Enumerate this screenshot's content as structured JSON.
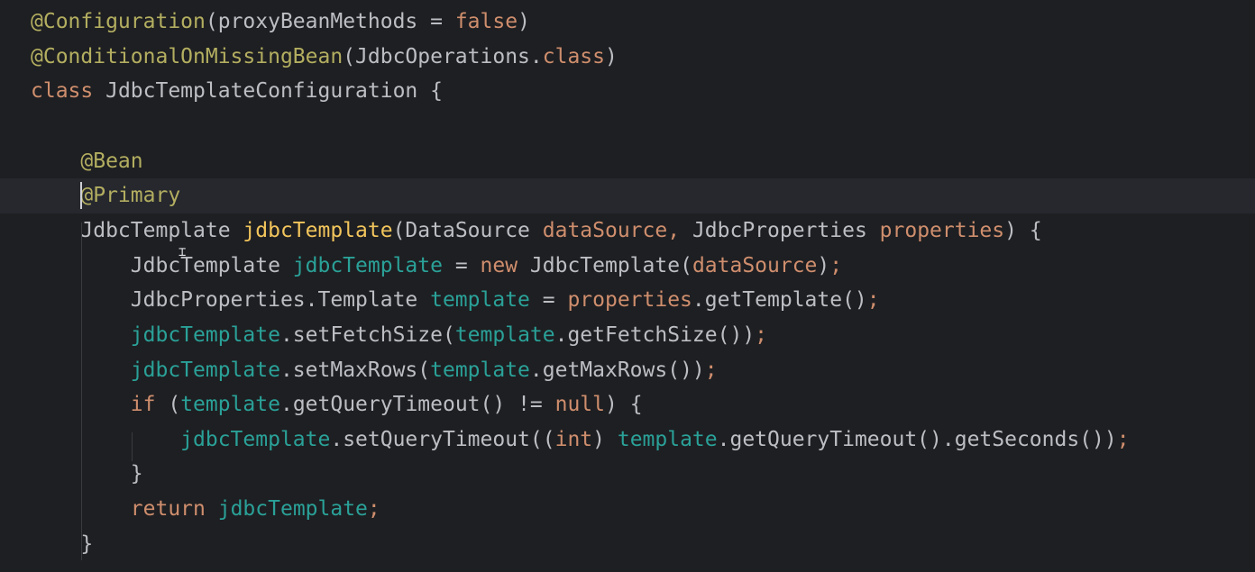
{
  "editor": {
    "colors": {
      "background": "#1e1f22",
      "text": "#bcbec4",
      "annotation": "#b3ae60",
      "keyword": "#cf8e6d",
      "method_declaration": "#f2c55c",
      "parameter": "#cf8e6d",
      "local_variable": "#2aa198",
      "current_line": "#26282e"
    },
    "lines": [
      {
        "tokens": [
          {
            "t": "@Configuration",
            "c": "annotation"
          },
          {
            "t": "(proxyBeanMethods = ",
            "c": "plain"
          },
          {
            "t": "false",
            "c": "keyword"
          },
          {
            "t": ")",
            "c": "plain"
          }
        ]
      },
      {
        "tokens": [
          {
            "t": "@ConditionalOnMissingBean",
            "c": "annotation"
          },
          {
            "t": "(JdbcOperations.",
            "c": "plain"
          },
          {
            "t": "class",
            "c": "keyword"
          },
          {
            "t": ")",
            "c": "plain"
          }
        ]
      },
      {
        "tokens": [
          {
            "t": "class",
            "c": "keyword"
          },
          {
            "t": " JdbcTemplateConfiguration {",
            "c": "plain"
          }
        ]
      },
      {
        "tokens": []
      },
      {
        "tokens": [
          {
            "t": "    ",
            "c": "plain"
          },
          {
            "t": "@Bean",
            "c": "annotation"
          }
        ]
      },
      {
        "tokens": [
          {
            "t": "    ",
            "c": "plain"
          },
          {
            "t": "@Primary",
            "c": "annotation"
          }
        ]
      },
      {
        "tokens": [
          {
            "t": "    JdbcTemplate ",
            "c": "plain"
          },
          {
            "t": "jdbcTemplate",
            "c": "methoddecl"
          },
          {
            "t": "(DataSource ",
            "c": "plain"
          },
          {
            "t": "dataSource",
            "c": "param"
          },
          {
            "t": ", ",
            "c": "keyword"
          },
          {
            "t": "JdbcProperties ",
            "c": "plain"
          },
          {
            "t": "properties",
            "c": "param"
          },
          {
            "t": ") {",
            "c": "plain"
          }
        ]
      },
      {
        "tokens": [
          {
            "t": "        JdbcTemplate ",
            "c": "plain"
          },
          {
            "t": "jdbcTemplate",
            "c": "local"
          },
          {
            "t": " = ",
            "c": "plain"
          },
          {
            "t": "new",
            "c": "keyword"
          },
          {
            "t": " JdbcTemplate(",
            "c": "plain"
          },
          {
            "t": "dataSource",
            "c": "param"
          },
          {
            "t": ")",
            "c": "plain"
          },
          {
            "t": ";",
            "c": "keyword"
          }
        ]
      },
      {
        "tokens": [
          {
            "t": "        JdbcProperties.Template ",
            "c": "plain"
          },
          {
            "t": "template",
            "c": "local"
          },
          {
            "t": " = ",
            "c": "plain"
          },
          {
            "t": "properties",
            "c": "param"
          },
          {
            "t": ".getTemplate()",
            "c": "plain"
          },
          {
            "t": ";",
            "c": "keyword"
          }
        ]
      },
      {
        "tokens": [
          {
            "t": "        ",
            "c": "plain"
          },
          {
            "t": "jdbcTemplate",
            "c": "local"
          },
          {
            "t": ".setFetchSize(",
            "c": "plain"
          },
          {
            "t": "template",
            "c": "local"
          },
          {
            "t": ".getFetchSize())",
            "c": "plain"
          },
          {
            "t": ";",
            "c": "keyword"
          }
        ]
      },
      {
        "tokens": [
          {
            "t": "        ",
            "c": "plain"
          },
          {
            "t": "jdbcTemplate",
            "c": "local"
          },
          {
            "t": ".setMaxRows(",
            "c": "plain"
          },
          {
            "t": "template",
            "c": "local"
          },
          {
            "t": ".getMaxRows())",
            "c": "plain"
          },
          {
            "t": ";",
            "c": "keyword"
          }
        ]
      },
      {
        "tokens": [
          {
            "t": "        ",
            "c": "plain"
          },
          {
            "t": "if",
            "c": "keyword"
          },
          {
            "t": " (",
            "c": "plain"
          },
          {
            "t": "template",
            "c": "local"
          },
          {
            "t": ".getQueryTimeout() != ",
            "c": "plain"
          },
          {
            "t": "null",
            "c": "keyword"
          },
          {
            "t": ") {",
            "c": "plain"
          }
        ]
      },
      {
        "tokens": [
          {
            "t": "            ",
            "c": "plain"
          },
          {
            "t": "jdbcTemplate",
            "c": "local"
          },
          {
            "t": ".setQueryTimeout((",
            "c": "plain"
          },
          {
            "t": "int",
            "c": "keyword"
          },
          {
            "t": ") ",
            "c": "plain"
          },
          {
            "t": "template",
            "c": "local"
          },
          {
            "t": ".getQueryTimeout().getSeconds())",
            "c": "plain"
          },
          {
            "t": ";",
            "c": "keyword"
          }
        ]
      },
      {
        "tokens": [
          {
            "t": "        }",
            "c": "plain"
          }
        ]
      },
      {
        "tokens": [
          {
            "t": "        ",
            "c": "plain"
          },
          {
            "t": "return",
            "c": "keyword"
          },
          {
            "t": " ",
            "c": "plain"
          },
          {
            "t": "jdbcTemplate",
            "c": "local"
          },
          {
            "t": ";",
            "c": "keyword"
          }
        ]
      },
      {
        "tokens": [
          {
            "t": "    }",
            "c": "plain"
          }
        ]
      }
    ]
  }
}
